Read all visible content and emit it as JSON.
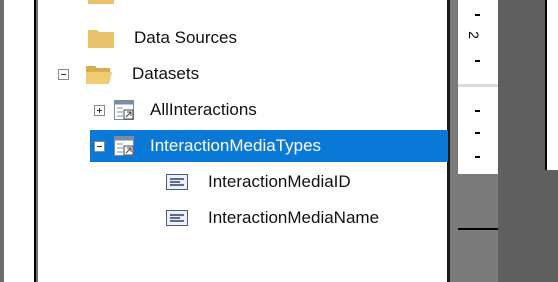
{
  "tree": {
    "items": [
      {
        "label": "Data Sources",
        "icon": "folder-icon"
      },
      {
        "label": "Datasets",
        "icon": "folder-open-icon",
        "expanded": true
      },
      {
        "label": "AllInteractions",
        "icon": "dataset-icon",
        "expanded": false
      },
      {
        "label": "InteractionMediaTypes",
        "icon": "dataset-icon",
        "expanded": true,
        "selected": true
      },
      {
        "label": "InteractionMediaID",
        "icon": "field-icon"
      },
      {
        "label": "InteractionMediaName",
        "icon": "field-icon"
      }
    ]
  },
  "ruler": {
    "number": "2"
  },
  "colors": {
    "selection": "#0a78d6",
    "folder": "#e8c36a"
  }
}
